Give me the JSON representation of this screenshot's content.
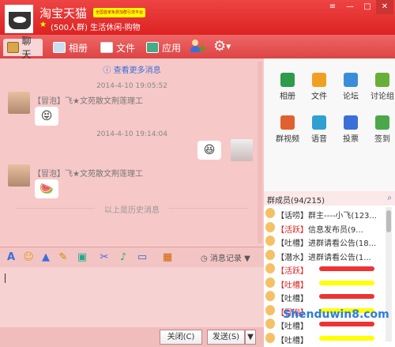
{
  "header": {
    "group_name": "淘宝天猫",
    "badge_text": "全国首家免费加群引流平台",
    "group_info": "(500人群) 生活休闲-购物"
  },
  "window_controls": [
    "≡",
    "—",
    "□",
    "✕"
  ],
  "tabs": [
    {
      "label": "聊天"
    },
    {
      "label": "相册"
    },
    {
      "label": "文件"
    },
    {
      "label": "应用"
    }
  ],
  "chat": {
    "more_messages": "查看更多消息",
    "messages": [
      {
        "time": "2014-4-10 19:05:52",
        "sender": "【冒泡】飞★文苑散文荆莲理工",
        "content": "😝"
      },
      {
        "time": "2014-4-10 19:14:04",
        "sender": "",
        "content": "😆"
      },
      {
        "sender": "【冒泡】飞★文苑散文荆莲理工",
        "content": "🍉"
      }
    ],
    "history_divider": "以上是历史消息"
  },
  "input_toolbar": {
    "message_record": "消息记录"
  },
  "bottom": {
    "close_button": "关闭(C)",
    "send_button": "发送(S)"
  },
  "apps": [
    {
      "label": "相册",
      "color": "#2e9b4a"
    },
    {
      "label": "文件",
      "color": "#f0a020"
    },
    {
      "label": "论坛",
      "color": "#3a8ed8"
    },
    {
      "label": "讨论组",
      "color": "#6aae3a"
    },
    {
      "label": "群视频",
      "color": "#e06030"
    },
    {
      "label": "语音",
      "color": "#2fa0d0"
    },
    {
      "label": "投票",
      "color": "#3a6fd8"
    },
    {
      "label": "签到",
      "color": "#4aa84a"
    }
  ],
  "members": {
    "header": "群成员(94/215)",
    "list": [
      {
        "tag": "【话唠】",
        "name": "群主----小飞(123...",
        "tag_color": "#333"
      },
      {
        "tag": "【活跃】",
        "name": "信息发布员(9...",
        "tag_color": "#d22"
      },
      {
        "tag": "【吐槽】",
        "name": "进群请看公告(18...",
        "tag_color": "#333"
      },
      {
        "tag": "【潜水】",
        "name": "进群请看公告(1...",
        "tag_color": "#333"
      },
      {
        "tag": "【活跃】",
        "name": "",
        "tag_color": "#d22"
      },
      {
        "tag": "【吐槽】",
        "name": "",
        "tag_color": "#d22"
      },
      {
        "tag": "【吐槽】",
        "name": "",
        "tag_color": "#333"
      },
      {
        "tag": "【冒泡】",
        "name": "",
        "tag_color": "#d22"
      },
      {
        "tag": "【吐槽】",
        "name": "",
        "tag_color": "#333"
      },
      {
        "tag": "【吐槽】",
        "name": "",
        "tag_color": "#333"
      }
    ]
  },
  "watermark": "Shenduwin8.com"
}
